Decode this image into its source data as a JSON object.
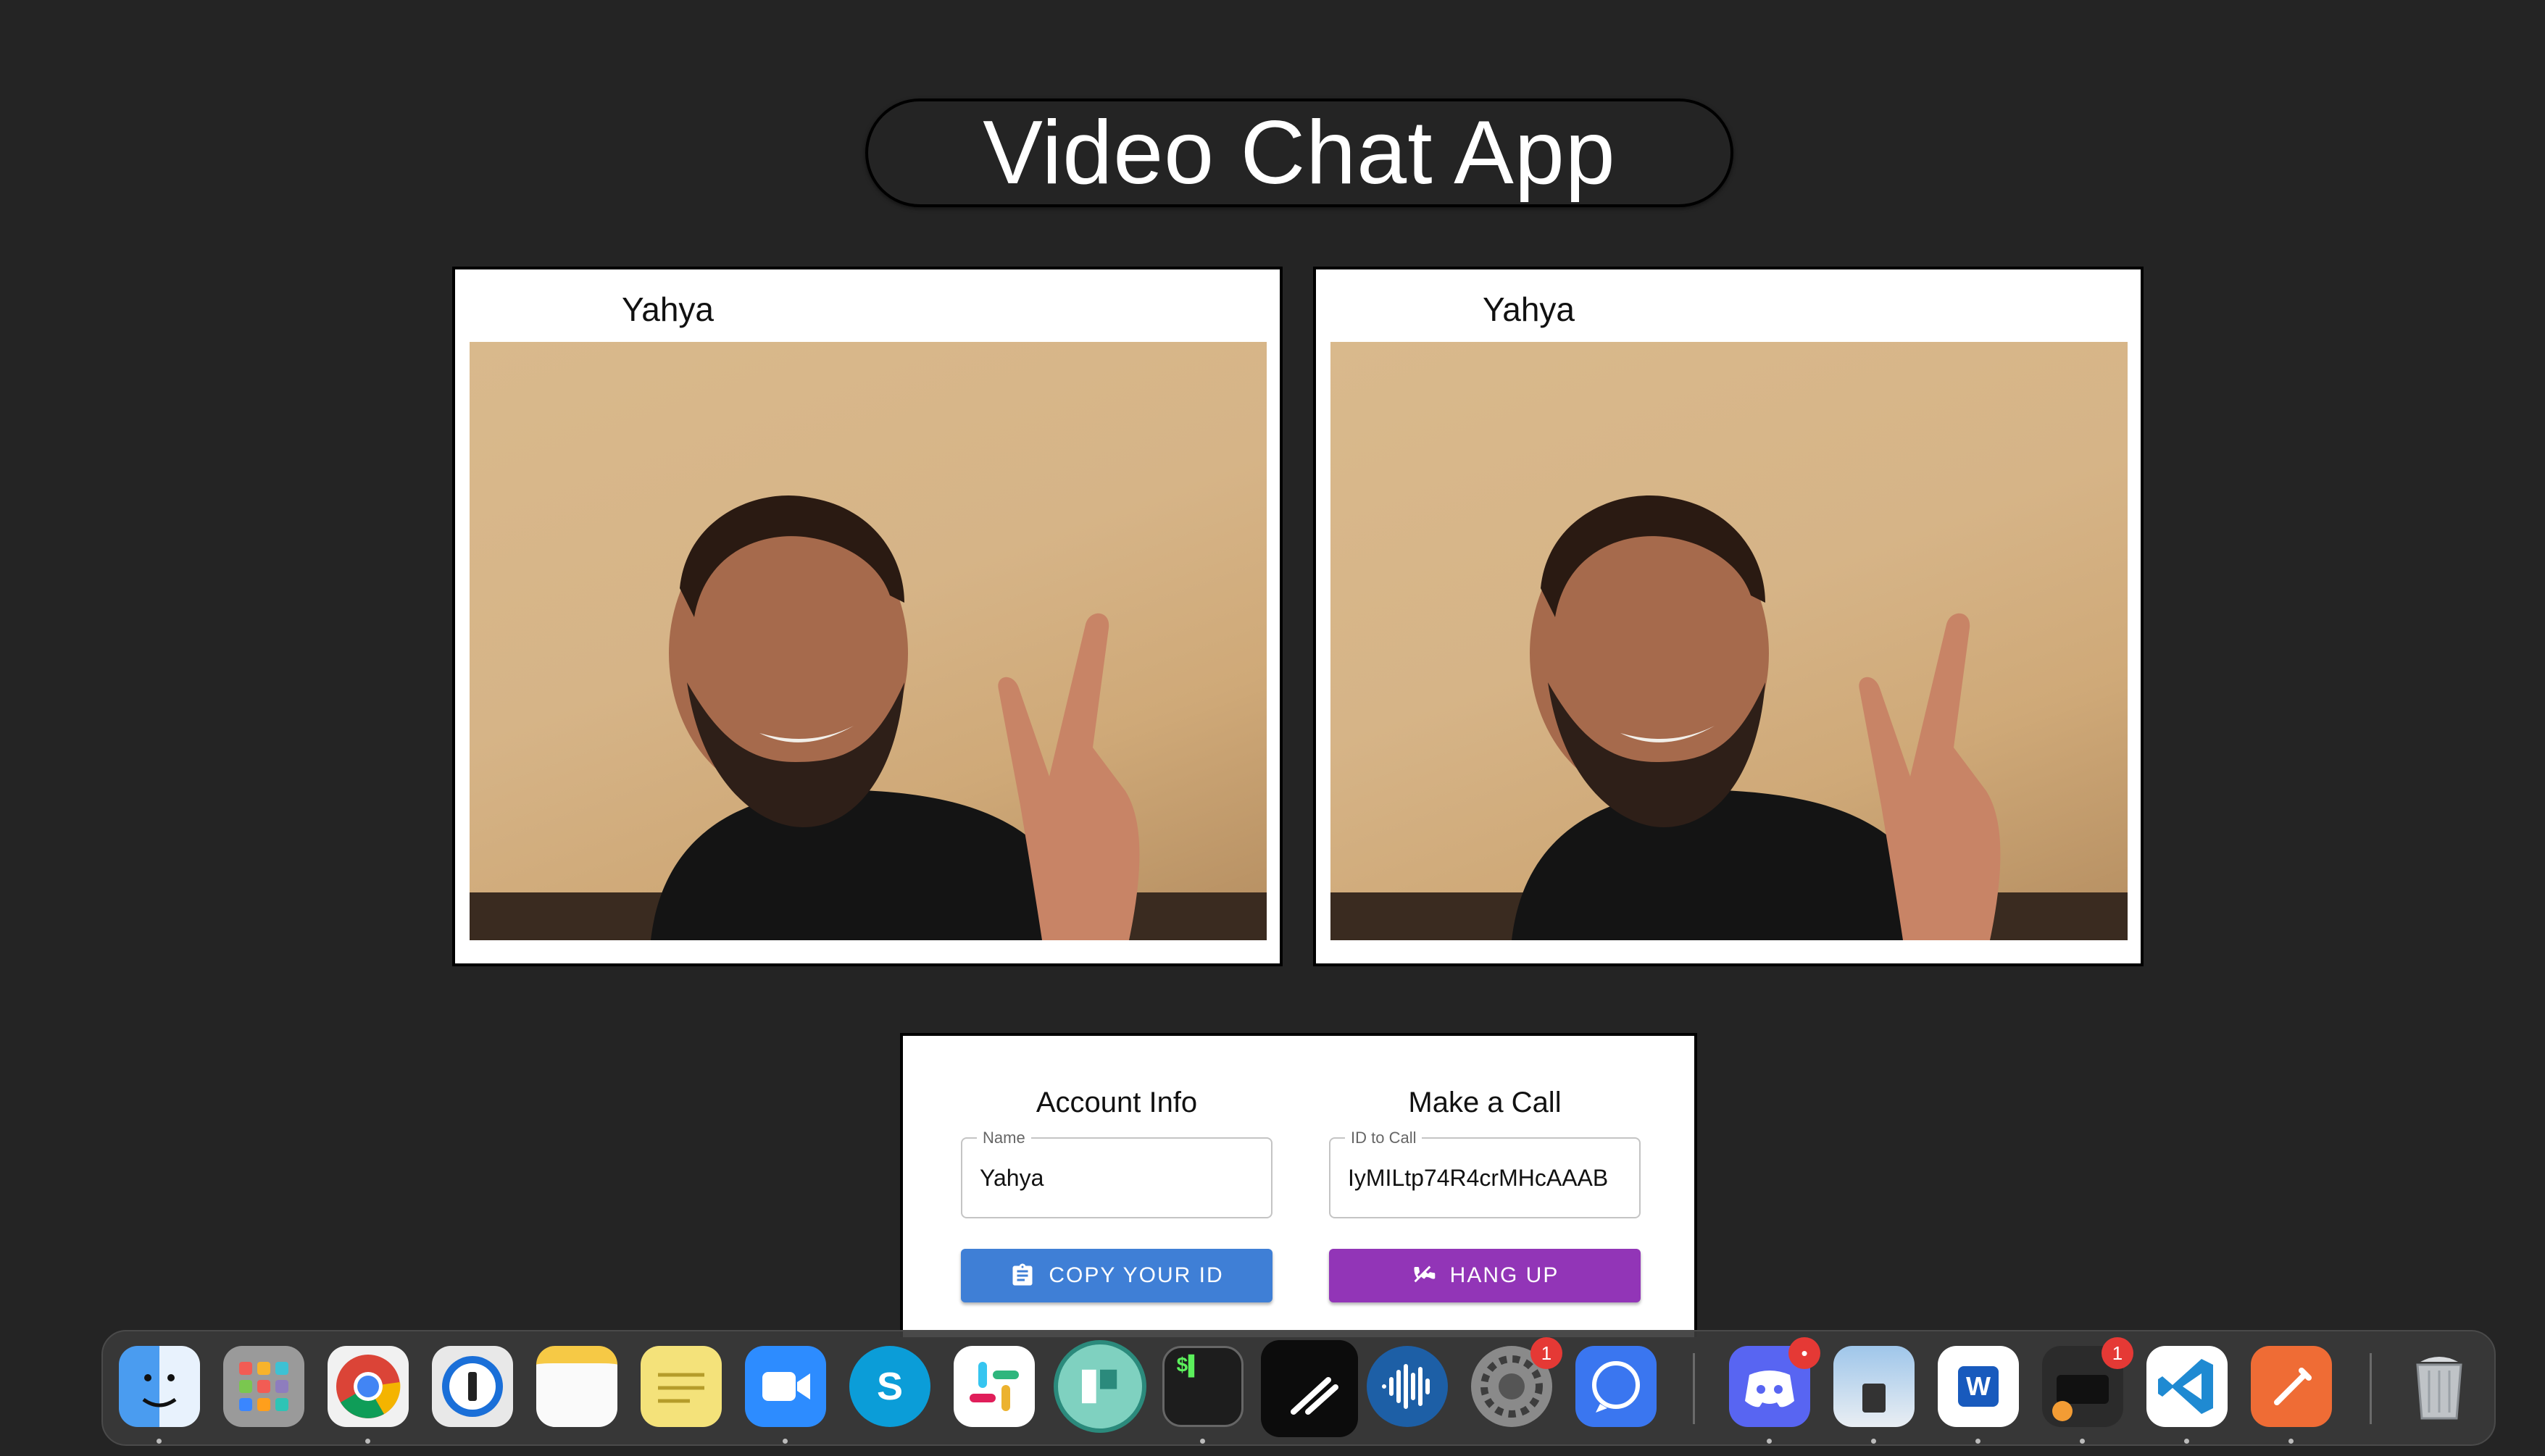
{
  "app": {
    "title": "Video Chat App"
  },
  "videos": [
    {
      "name": "Yahya"
    },
    {
      "name": "Yahya"
    }
  ],
  "account": {
    "title": "Account Info",
    "name_label": "Name",
    "name_value": "Yahya",
    "copy_label": "COPY YOUR ID"
  },
  "call": {
    "title": "Make a Call",
    "id_label": "ID to Call",
    "id_value": "IyMILtp74R4crMHcAAAB",
    "hangup_label": "HANG UP"
  },
  "colors": {
    "background": "#242424",
    "copy_button": "#3f7fd6",
    "hangup_button": "#9235b7"
  },
  "dock": {
    "apps": [
      {
        "name": "finder-icon"
      },
      {
        "name": "launchpad-icon"
      },
      {
        "name": "chrome-icon"
      },
      {
        "name": "1password-icon"
      },
      {
        "name": "notes-icon"
      },
      {
        "name": "stickies-icon"
      },
      {
        "name": "zoom-icon"
      },
      {
        "name": "skype-icon"
      },
      {
        "name": "slack-icon"
      },
      {
        "name": "teal-app-icon"
      },
      {
        "name": "terminal-icon"
      },
      {
        "name": "linear-icon"
      },
      {
        "name": "audio-wave-icon"
      },
      {
        "name": "system-preferences-icon",
        "badge": "1"
      },
      {
        "name": "signal-icon"
      },
      {
        "name": "discord-icon",
        "badge": "•"
      },
      {
        "name": "preview-icon"
      },
      {
        "name": "word-icon"
      },
      {
        "name": "printer-icon",
        "badge": "1"
      },
      {
        "name": "vscode-icon"
      },
      {
        "name": "postman-icon"
      },
      {
        "name": "trash-icon"
      }
    ]
  }
}
